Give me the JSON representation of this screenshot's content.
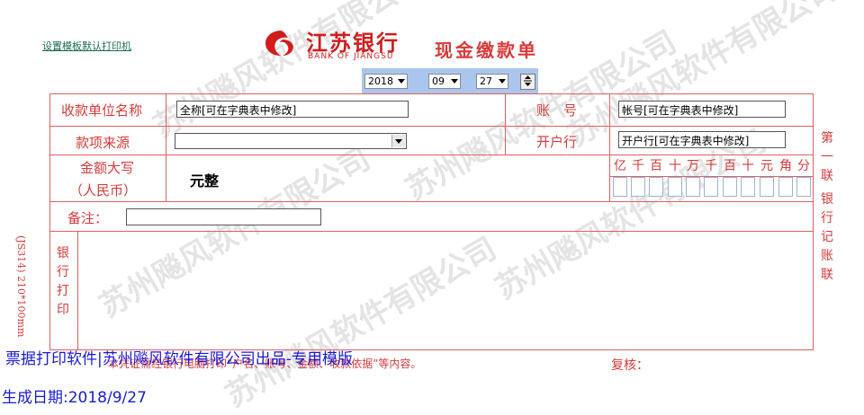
{
  "watermark_text": "苏州飚风软件有限公司",
  "header": {
    "set_printer_link": "设置模板默认打印机",
    "bank_name_cn": "江苏银行",
    "bank_name_en": "BANK OF JIANGSU",
    "form_title": "现金缴款单"
  },
  "date": {
    "year": "2018",
    "month": "09",
    "day": "27"
  },
  "form": {
    "payee_unit_label": "收款单位名称",
    "payee_unit_value": "全称[可在字典表中修改]",
    "account_label": "账　号",
    "account_value": "帐号[可在字典表中修改]",
    "source_label": "款项来源",
    "source_value": "",
    "bank_label": "开户行",
    "bank_value": "开户行[可在字典表中修改]",
    "amount_label_1": "金额大写",
    "amount_label_2": "（人民币）",
    "amount_words": "元整",
    "digit_headers": [
      "亿",
      "千",
      "百",
      "十",
      "万",
      "千",
      "百",
      "十",
      "元",
      "角",
      "分"
    ],
    "memo_label": "备注：",
    "memo_value": "",
    "bank_print_label": "银行打印",
    "side_code": "(JS314) 210*100mm",
    "review_label": "复核：",
    "bottom_hint": "本凭证需经银行电脑打印“户名、账号、金额、收款依据”等内容。",
    "copy_label_1": "第一联",
    "copy_label_2": "银行记账联"
  },
  "footer": {
    "line1": "票据打印软件|苏州飚风软件有限公司出品-专用模版",
    "line2": "生成日期:2018/9/27"
  },
  "colors": {
    "form_red": "#d83a3a",
    "brand_red": "#d21d1d",
    "date_bar": "#aac6ee",
    "footer_blue": "#1a1ad6"
  }
}
